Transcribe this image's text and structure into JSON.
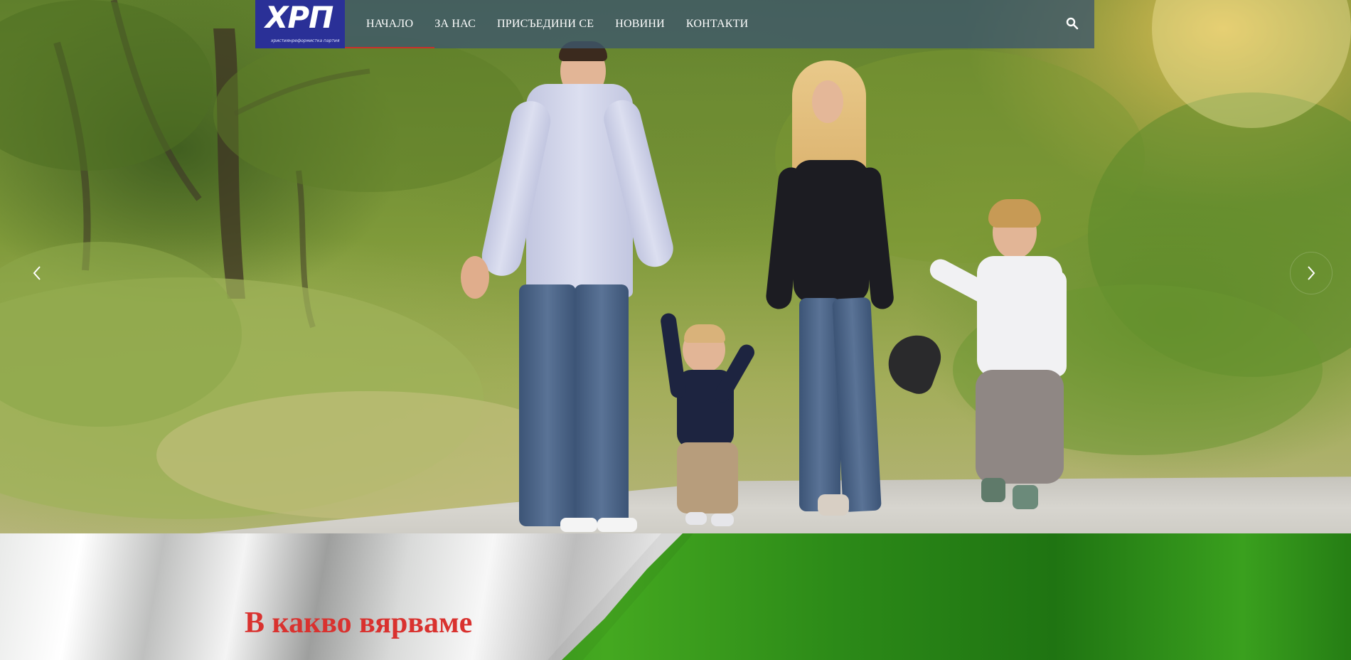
{
  "brand": {
    "logo_text": "ХРП",
    "logo_tagline": "християнреформистка партия",
    "colors": {
      "logo_bg": "#2a3097",
      "accent": "#c9302c",
      "heading": "#d9322f",
      "flag_green": "#2f8f18"
    }
  },
  "nav": {
    "items": [
      {
        "label": "НАЧАЛО",
        "active": true
      },
      {
        "label": "ЗА НАС",
        "active": false
      },
      {
        "label": "ПРИСЪЕДИНИ СЕ",
        "active": false
      },
      {
        "label": "НОВИНИ",
        "active": false
      },
      {
        "label": "КОНТАКТИ",
        "active": false
      }
    ],
    "search_icon": "search-icon"
  },
  "hero": {
    "prev_icon": "chevron-left-icon",
    "next_icon": "chevron-right-icon"
  },
  "section": {
    "title": "В какво вярваме"
  }
}
